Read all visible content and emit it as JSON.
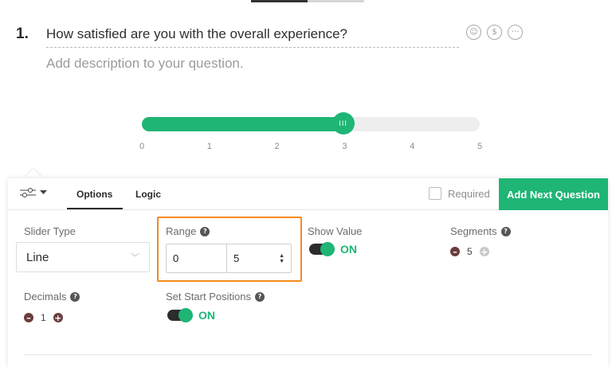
{
  "question": {
    "number": "1.",
    "title": "How satisfied are you with the overall experience?",
    "description": "Add description to your question.",
    "icons": [
      "smiley-icon",
      "dollar-icon",
      "more-icon"
    ]
  },
  "slider": {
    "value": 3,
    "min": 0,
    "max": 5,
    "ticks": [
      "0",
      "1",
      "2",
      "3",
      "4",
      "5"
    ],
    "handle_glyph": "III",
    "accent_color": "#1eb575"
  },
  "panel": {
    "tabs": [
      {
        "label": "Options",
        "active": true
      },
      {
        "label": "Logic",
        "active": false
      }
    ],
    "required_label": "Required",
    "add_next_label": "Add Next Question",
    "slider_type": {
      "label": "Slider Type",
      "value": "Line"
    },
    "range": {
      "label": "Range",
      "min": "0",
      "max": "5"
    },
    "show_value": {
      "label": "Show Value",
      "state": "ON"
    },
    "segments": {
      "label": "Segments",
      "value": "5"
    },
    "decimals": {
      "label": "Decimals",
      "value": "1"
    },
    "start_positions": {
      "label": "Set Start Positions",
      "state": "ON"
    }
  },
  "colors": {
    "accent": "#1eb575",
    "highlight": "#f5891f"
  }
}
